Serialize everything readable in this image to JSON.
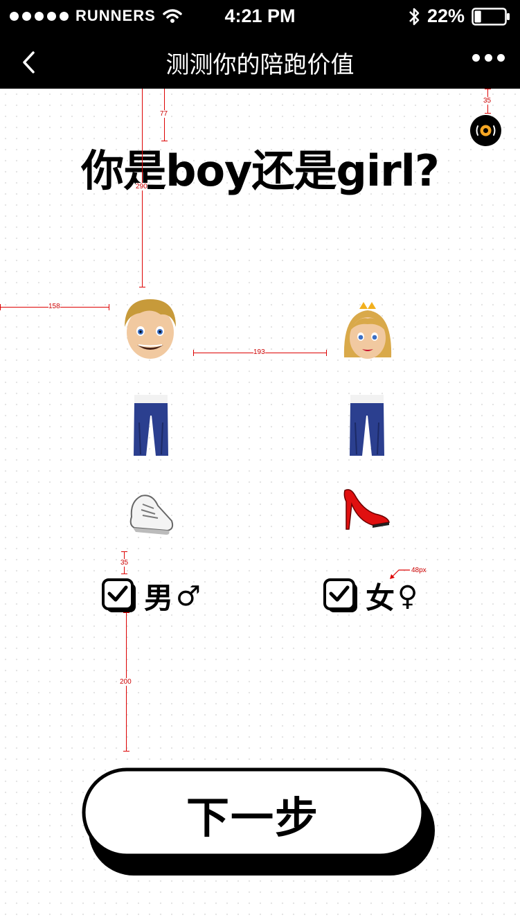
{
  "status_bar": {
    "carrier": "RUNNERS",
    "time": "4:21 PM",
    "battery_percent": "22%",
    "battery_level": 0.22
  },
  "nav": {
    "title": "测测你的陪跑价值",
    "back_icon": "chevron-left-icon",
    "more_icon": "more-dots-icon"
  },
  "headline": "你是boy还是girl?",
  "options": {
    "male": {
      "label": "男",
      "symbol": "♂"
    },
    "female": {
      "label": "女",
      "symbol": "♀"
    }
  },
  "next_button": {
    "label": "下一步"
  },
  "annotations": {
    "a35_top": "35",
    "a77": "77",
    "a290": "290",
    "a158": "158",
    "a193": "193",
    "a35_mid": "35",
    "a48": "48px",
    "a200": "200"
  },
  "colors": {
    "bar_bg": "#000000",
    "annotation": "#cc0000",
    "music_accent": "#f5a623"
  }
}
